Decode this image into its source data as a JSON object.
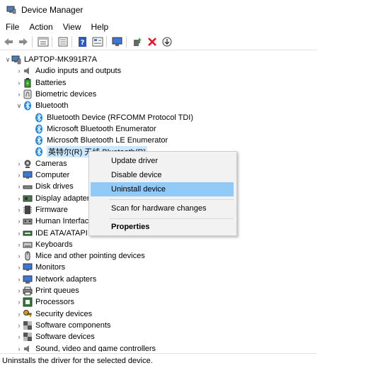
{
  "window": {
    "title": "Device Manager"
  },
  "menu": [
    "File",
    "Action",
    "View",
    "Help"
  ],
  "toolbar": [
    "back-icon",
    "forward-icon",
    "properties-icon",
    "show-hidden-icon",
    "help-icon",
    "view-resources-icon",
    "scan-hardware-icon",
    "update-driver-icon",
    "disable-device-icon",
    "uninstall-device-icon"
  ],
  "tree": {
    "root": "LAPTOP-MK991R7A",
    "categories": [
      {
        "label": "Audio inputs and outputs",
        "icon": "speaker-icon"
      },
      {
        "label": "Batteries",
        "icon": "battery-icon"
      },
      {
        "label": "Biometric devices",
        "icon": "fingerprint-icon"
      },
      {
        "label": "Bluetooth",
        "icon": "bluetooth-icon",
        "expanded": true,
        "children": [
          "Bluetooth Device (RFCOMM Protocol TDI)",
          "Microsoft Bluetooth Enumerator",
          "Microsoft Bluetooth LE Enumerator",
          "英特尔(R) 无线 Bluetooth(R)"
        ]
      },
      {
        "label": "Cameras",
        "icon": "camera-icon"
      },
      {
        "label": "Computer",
        "icon": "monitor-icon"
      },
      {
        "label": "Disk drives",
        "icon": "disk-icon"
      },
      {
        "label": "Display adapters",
        "icon": "display-adapter-icon"
      },
      {
        "label": "Firmware",
        "icon": "firmware-icon"
      },
      {
        "label": "Human Interface Devices",
        "icon": "hid-icon"
      },
      {
        "label": "IDE ATA/ATAPI controllers",
        "icon": "ide-icon"
      },
      {
        "label": "Keyboards",
        "icon": "keyboard-icon"
      },
      {
        "label": "Mice and other pointing devices",
        "icon": "mouse-icon"
      },
      {
        "label": "Monitors",
        "icon": "monitor-icon"
      },
      {
        "label": "Network adapters",
        "icon": "network-icon"
      },
      {
        "label": "Print queues",
        "icon": "printer-icon"
      },
      {
        "label": "Processors",
        "icon": "processor-icon"
      },
      {
        "label": "Security devices",
        "icon": "security-icon"
      },
      {
        "label": "Software components",
        "icon": "component-icon"
      },
      {
        "label": "Software devices",
        "icon": "component-icon"
      },
      {
        "label": "Sound, video and game controllers",
        "icon": "speaker-icon"
      }
    ]
  },
  "context_menu": {
    "items": [
      "Update driver",
      "Disable device",
      "Uninstall device",
      "Scan for hardware changes",
      "Properties"
    ],
    "highlighted": "Uninstall device"
  },
  "status": "Uninstalls the driver for the selected device.",
  "colors": {
    "bluetooth": "#1e88e5",
    "highlight": "#91c9f7",
    "selection": "#cce8ff",
    "red_x": "#e81123",
    "green_arrow": "#2e9d3a"
  }
}
